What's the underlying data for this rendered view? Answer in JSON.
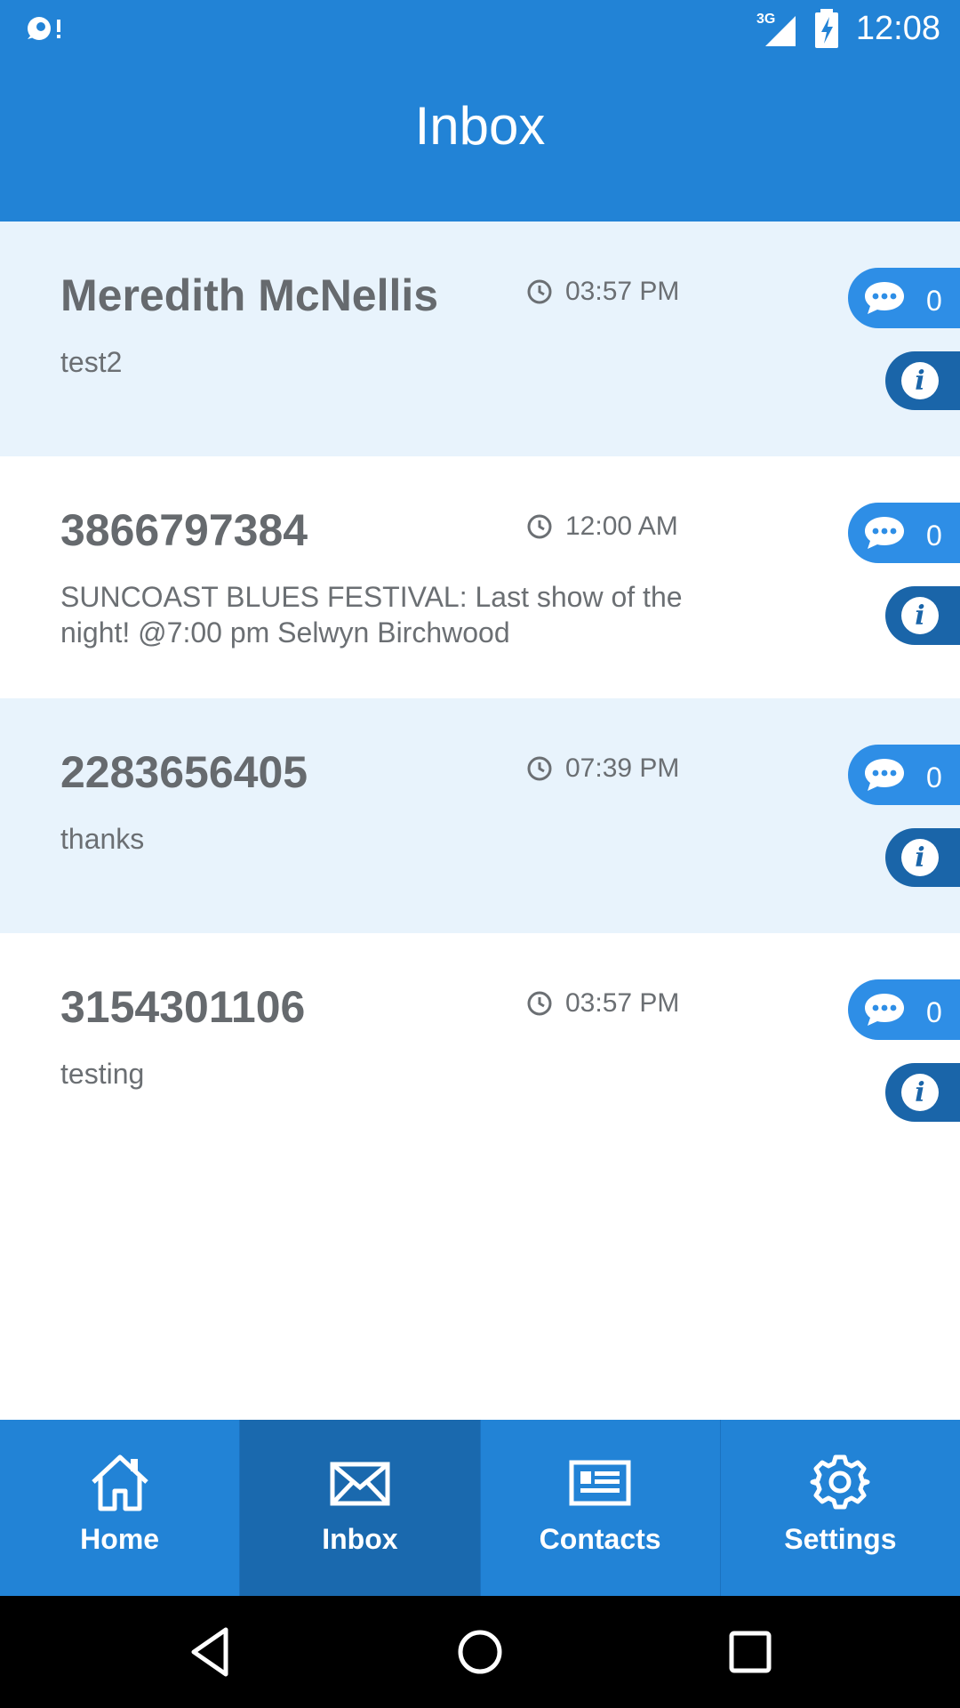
{
  "status": {
    "network": "3G",
    "time": "12:08"
  },
  "header": {
    "title": "Inbox"
  },
  "messages": [
    {
      "sender": "Meredith McNellis",
      "time": "03:57 PM",
      "preview": "test2",
      "count": "0"
    },
    {
      "sender": "3866797384",
      "time": "12:00 AM",
      "preview": "SUNCOAST BLUES FESTIVAL: Last show of the night! @7:00 pm Selwyn Birchwood",
      "count": "0"
    },
    {
      "sender": "2283656405",
      "time": "07:39 PM",
      "preview": "thanks",
      "count": "0"
    },
    {
      "sender": "3154301106",
      "time": "03:57 PM",
      "preview": "testing",
      "count": "0"
    }
  ],
  "tabs": [
    {
      "label": "Home",
      "icon": "home-icon",
      "active": false
    },
    {
      "label": "Inbox",
      "icon": "envelope-icon",
      "active": true
    },
    {
      "label": "Contacts",
      "icon": "contact-card-icon",
      "active": false
    },
    {
      "label": "Settings",
      "icon": "gear-icon",
      "active": false
    }
  ],
  "colors": {
    "primary": "#2283d6",
    "active_tab": "#1a69ae",
    "row_shaded": "#e8f3fc",
    "info": "#1a65a9"
  }
}
